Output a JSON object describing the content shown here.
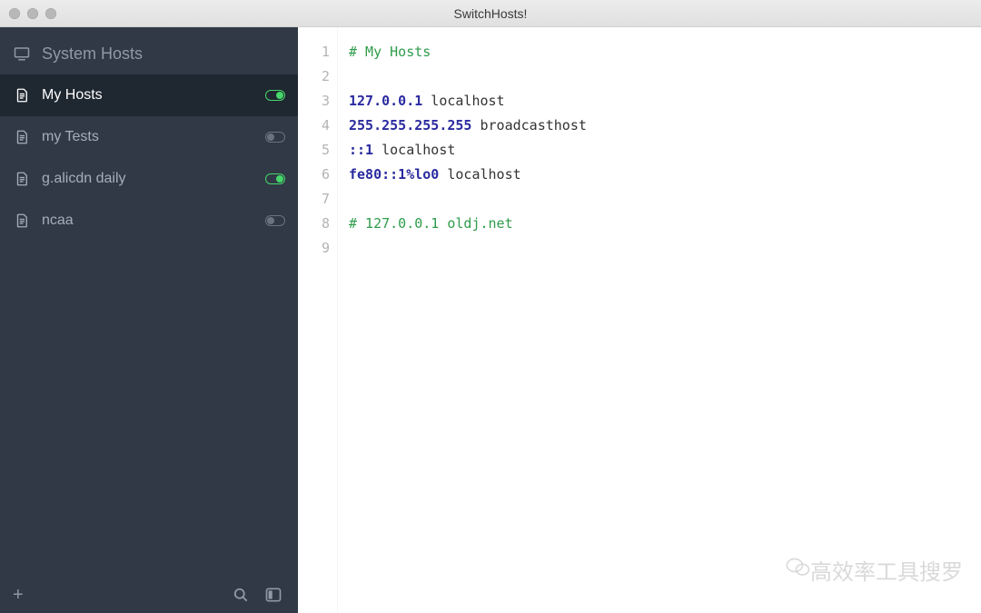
{
  "window": {
    "title": "SwitchHosts!"
  },
  "sidebar": {
    "system_label": "System Hosts",
    "items": [
      {
        "label": "My Hosts",
        "enabled": true,
        "selected": true
      },
      {
        "label": "my Tests",
        "enabled": false,
        "selected": false
      },
      {
        "label": "g.alicdn daily",
        "enabled": true,
        "selected": false
      },
      {
        "label": "ncaa",
        "enabled": false,
        "selected": false
      }
    ]
  },
  "editor": {
    "lines": [
      {
        "n": "1",
        "tokens": [
          {
            "cls": "tok-comment",
            "t": "# My Hosts"
          }
        ]
      },
      {
        "n": "2",
        "tokens": []
      },
      {
        "n": "3",
        "tokens": [
          {
            "cls": "tok-ip",
            "t": "127.0.0.1"
          },
          {
            "cls": "",
            "t": " localhost"
          }
        ]
      },
      {
        "n": "4",
        "tokens": [
          {
            "cls": "tok-ip",
            "t": "255.255.255.255"
          },
          {
            "cls": "",
            "t": " broadcasthost"
          }
        ]
      },
      {
        "n": "5",
        "tokens": [
          {
            "cls": "tok-ip",
            "t": "::1"
          },
          {
            "cls": "",
            "t": " localhost"
          }
        ]
      },
      {
        "n": "6",
        "tokens": [
          {
            "cls": "tok-ip",
            "t": "fe80::1%lo0"
          },
          {
            "cls": "",
            "t": " localhost"
          }
        ]
      },
      {
        "n": "7",
        "tokens": []
      },
      {
        "n": "8",
        "tokens": [
          {
            "cls": "tok-comment",
            "t": "# 127.0.0.1 oldj.net"
          }
        ]
      },
      {
        "n": "9",
        "tokens": []
      }
    ]
  },
  "watermark": {
    "text": "高效率工具搜罗"
  }
}
